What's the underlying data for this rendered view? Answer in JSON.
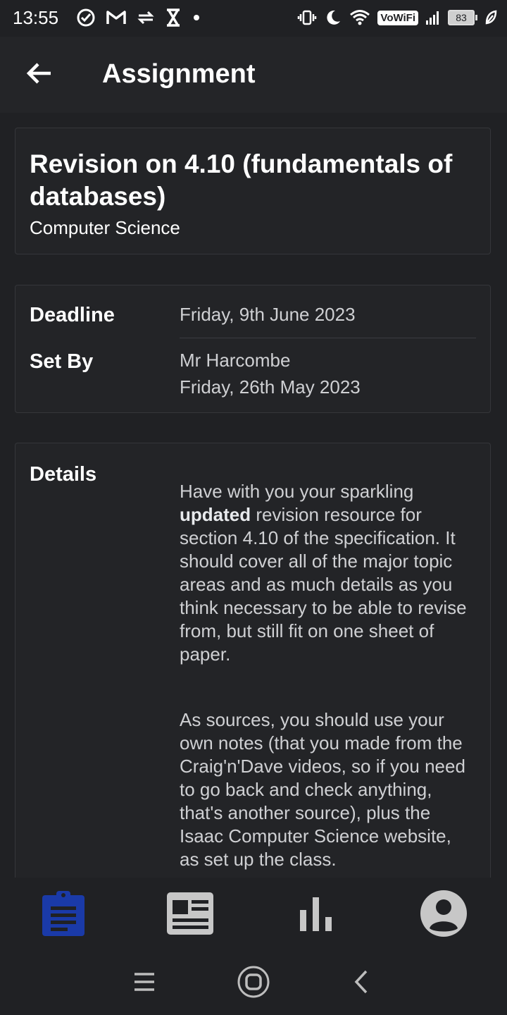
{
  "status_bar": {
    "time": "13:55",
    "vowifi": "VoWiFi",
    "battery": "83",
    "left_icons": [
      "check-circle-icon",
      "gmail-icon",
      "data-transfer-icon",
      "hourglass-icon",
      "dot-icon"
    ],
    "right_icons": [
      "vibrate-icon",
      "moon-icon",
      "wifi-icon",
      "signal-icon",
      "battery-icon",
      "leaf-icon"
    ]
  },
  "app_bar": {
    "title": "Assignment"
  },
  "assignment": {
    "title": "Revision on 4.10 (fundamentals of databases)",
    "subject": "Computer Science"
  },
  "info": {
    "deadline_label": "Deadline",
    "deadline_value": "Friday, 9th June 2023",
    "set_by_label": "Set By",
    "set_by_name": "Mr Harcombe",
    "set_by_date": "Friday, 26th May 2023"
  },
  "details": {
    "label": "Details",
    "para1_a": "Have with you your sparkling ",
    "para1_bold": "updated",
    "para1_b": " revision resource for section 4.10 of the specification. It should cover all of the major topic areas and as much details as you think necessary to be able to revise from, but still fit on one sheet of paper.",
    "para2": "As sources, you should use your own notes (that you made from the Craig'n'Dave videos, so if you need to go back and check anything, that's another source), plus the Isaac Computer Science website, as set up the class."
  },
  "bottom_nav": {
    "items": [
      "assignments",
      "news",
      "stats",
      "profile"
    ],
    "active_color": "#1a3aa8",
    "inactive_color": "#c7c7c7"
  },
  "colors": {
    "background": "#202124",
    "card": "#232427",
    "text": "#e8eaed"
  }
}
